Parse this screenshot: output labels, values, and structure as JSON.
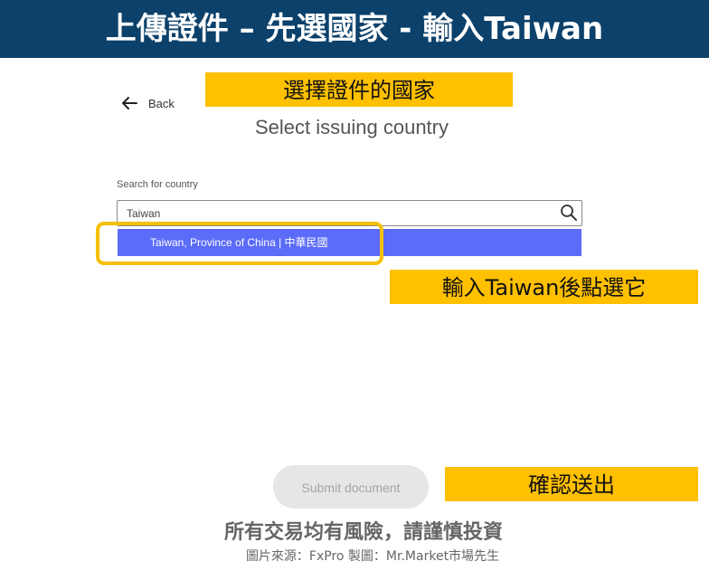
{
  "banner": {
    "title": "上傳證件 – 先選國家 -  輸入Taiwan"
  },
  "annotations": {
    "choose_country": "選擇證件的國家",
    "type_taiwan": "輸入Taiwan後點選它",
    "confirm_submit": "確認送出"
  },
  "header": {
    "back_label": "Back",
    "heading": "Select issuing country"
  },
  "search": {
    "label": "Search for country",
    "value": "Taiwan"
  },
  "dropdown": {
    "option": "Taiwan, Province of China | 中華民國"
  },
  "footer": {
    "submit_label": "Submit document",
    "risk_text": "所有交易均有風險，請謹慎投資",
    "source_text": "圖片來源：FxPro 製圖：Mr.Market市場先生"
  },
  "colors": {
    "banner": "#0b416b",
    "note": "#ffc000",
    "dropdown_highlight": "#5b6cf8",
    "highlight_ring": "#f5c000",
    "submit_disabled": "#e6e6e6"
  },
  "icons": {
    "back": "arrow-left-icon",
    "search": "magnifier-icon"
  }
}
